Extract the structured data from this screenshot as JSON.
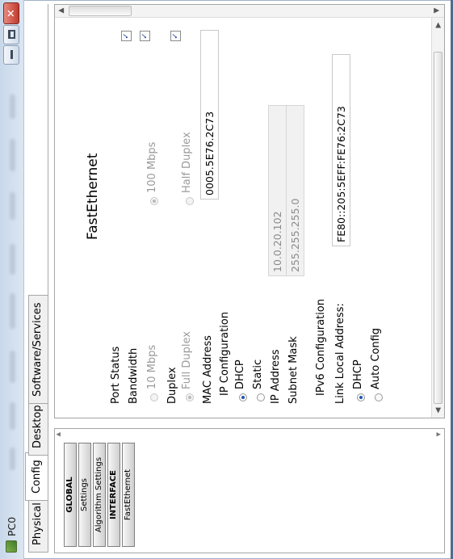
{
  "window": {
    "title": "PC0",
    "icon_name": "pc-icon",
    "controls": [
      "minimize-icon",
      "maximize-icon",
      "close-icon"
    ]
  },
  "tabs": [
    {
      "label": "Physical",
      "active": false
    },
    {
      "label": "Config",
      "active": true
    },
    {
      "label": "Desktop",
      "active": false
    },
    {
      "label": "Software/Services",
      "active": false
    }
  ],
  "sidebar": {
    "items": [
      {
        "label": "GLOBAL",
        "header": true
      },
      {
        "label": "Settings",
        "header": false
      },
      {
        "label": "Algorithm Settings",
        "header": false
      },
      {
        "label": "INTERFACE",
        "header": true
      },
      {
        "label": "FastEthernet",
        "header": false
      }
    ]
  },
  "panel": {
    "title": "FastEthernet",
    "port_status": {
      "label": "Port Status",
      "checked": true
    },
    "bandwidth": {
      "label": "Bandwidth",
      "auto_checked": true,
      "options": [
        "10 Mbps",
        "100 Mbps"
      ],
      "selected": "100 Mbps"
    },
    "duplex": {
      "label": "Duplex",
      "auto_checked": true,
      "options": [
        "Full Duplex",
        "Half Duplex"
      ]
    },
    "mac": {
      "label": "MAC Address",
      "value": "0005.5E76.2C73"
    },
    "ip_config": {
      "label": "IP Configuration",
      "dhcp": "DHCP",
      "static": "Static",
      "mode": "DHCP"
    },
    "ip_address": {
      "label": "IP Address",
      "value": "10.0.20.102"
    },
    "subnet_mask": {
      "label": "Subnet Mask",
      "value": "255.255.255.0"
    },
    "ipv6_config": {
      "label": "IPv6 Configuration"
    },
    "link_local": {
      "label": "Link Local Address:",
      "value": "FE80::205:5EFF:FE76:2C73"
    },
    "ipv6_dhcp": "DHCP",
    "ipv6_auto": "Auto Config",
    "ipv6_mode": "DHCP"
  },
  "colors": {
    "accent": "#1f55b7",
    "close_button": "#c9463d",
    "window_border": "#6f8aa8"
  }
}
